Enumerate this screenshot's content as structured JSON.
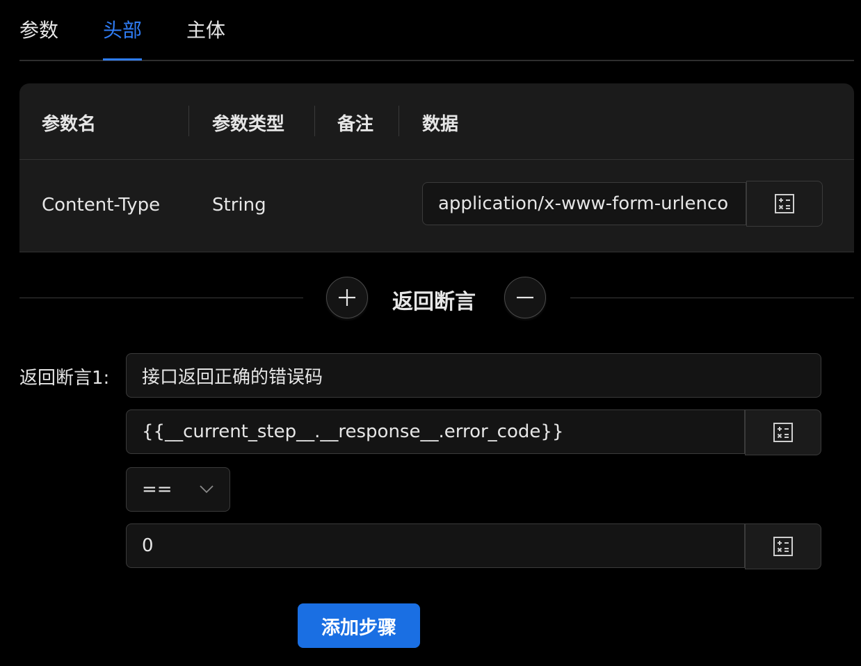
{
  "tabs": [
    {
      "label": "参数",
      "active": false
    },
    {
      "label": "头部",
      "active": true
    },
    {
      "label": "主体",
      "active": false
    }
  ],
  "colors": {
    "accent": "#2f7df6",
    "primary_button": "#1a6fe3",
    "background": "#000000",
    "panel": "#1b1b1b"
  },
  "headers_table": {
    "columns": [
      "参数名",
      "参数类型",
      "备注",
      "数据"
    ],
    "rows": [
      {
        "name": "Content-Type",
        "type": "String",
        "remark": "",
        "data": "application/x-www-form-urlenco"
      }
    ]
  },
  "assertion_divider": {
    "label": "返回断言",
    "add_icon": "plus-icon",
    "remove_icon": "minus-icon"
  },
  "assertions": [
    {
      "label": "返回断言1:",
      "description": "接口返回正确的错误码",
      "expression": "{{__current_step__.__response__.error_code}}",
      "operator": "==",
      "expected": "0"
    }
  ],
  "icons": {
    "variable": "calculator-icon",
    "dropdown": "chevron-down-icon"
  },
  "actions": {
    "add_step_label": "添加步骤"
  }
}
